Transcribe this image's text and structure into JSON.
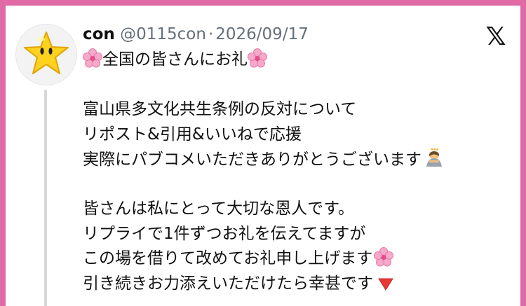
{
  "post": {
    "author_name": "con",
    "handle": "@0115con",
    "separator": "·",
    "date": "2026/09/17",
    "title_text": "全国の皆さんにお礼",
    "paragraph1": [
      "富山県多文化共生条例の反対について",
      "リポスト&引用&いいねで応援",
      "実際にパブコメいただきありがとうございます"
    ],
    "paragraph2": [
      "皆さんは私にとって大切な恩人です。",
      "リプライで1件ずつお礼を伝えてますが",
      "この場を借りて改めてお礼申し上げます",
      "引き続きお力添えいただけたら幸甚です"
    ]
  },
  "icons": {
    "avatar": "star-avatar",
    "brand": "x-logo-icon",
    "flower": "cherry-blossom-icon",
    "bow": "bowing-person-icon",
    "triangle": "red-triangle-down-icon"
  },
  "colors": {
    "frame": "#e06aa6",
    "handle": "#65707b",
    "thread": "#d7d7d7"
  }
}
